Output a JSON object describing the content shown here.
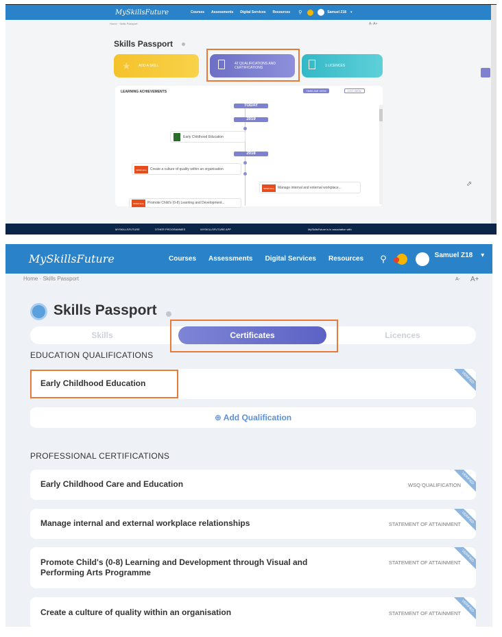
{
  "top": {
    "logo": "MySkillsFuture",
    "nav": [
      "Courses",
      "Assessments",
      "Digital Services",
      "Resources"
    ],
    "user": "Samuel Z18",
    "breadcrumb": "Home · Skills Passport",
    "font_controls": "A-  A+",
    "title": "Skills Passport",
    "cards": {
      "skill": "ADD A SKILL",
      "quals_count": "42",
      "quals": "QUALIFICATIONS AND CERTIFICATIONS",
      "licences": "1 LICENCES"
    },
    "panel_title": "LEARNING ACHIEVEMENTS",
    "timeline_view": "TIMELINE VIEW",
    "list_view": "LIST VIEW",
    "timeline": {
      "today": "TODAY",
      "y1": "2019",
      "y2": "2018",
      "items": [
        "Early Childhood Education",
        "Create a culture of quality within an organisation",
        "Manage internal and external workplace...",
        "Promote Child's (0-8) Learning and Development..."
      ],
      "logo_text": "SkillsFuture"
    },
    "footer": [
      "MYSKILLSFUTURE",
      "OTHER PROGRAMMES",
      "MYSKILLSFUTURE APP",
      "MySkillsFuture is in association with"
    ]
  },
  "bottom": {
    "logo": "MySkillsFuture",
    "nav": [
      "Courses",
      "Assessments",
      "Digital Services",
      "Resources"
    ],
    "user": "Samuel Z18",
    "breadcrumb": "Home · Skills Passport",
    "font_small": "A-",
    "font_large": "A+",
    "title": "Skills Passport",
    "tabs": [
      "Skills",
      "Certificates",
      "Licences"
    ],
    "edu_heading": "EDUCATION QUALIFICATIONS",
    "edu_item": "Early Childhood Education",
    "add_qual": "Add Qualification",
    "prof_heading": "PROFESSIONAL CERTIFICATIONS",
    "verified": "VERIFIED",
    "certs": [
      {
        "name": "Early Childhood Care and Education",
        "type": "WSQ QUALIFICATION"
      },
      {
        "name": "Manage internal and external workplace relationships",
        "type": "STATEMENT OF ATTAINMENT"
      },
      {
        "name": "Promote Child's (0-8) Learning and Development through Visual and Performing Arts Programme",
        "type": "STATEMENT OF ATTAINMENT"
      },
      {
        "name": "Create a culture of quality within an organisation",
        "type": "STATEMENT OF ATTAINMENT"
      }
    ]
  },
  "colors": {
    "nav": "#2a82c8",
    "accent": "#7d81cf",
    "highlight": "#e87a35"
  }
}
